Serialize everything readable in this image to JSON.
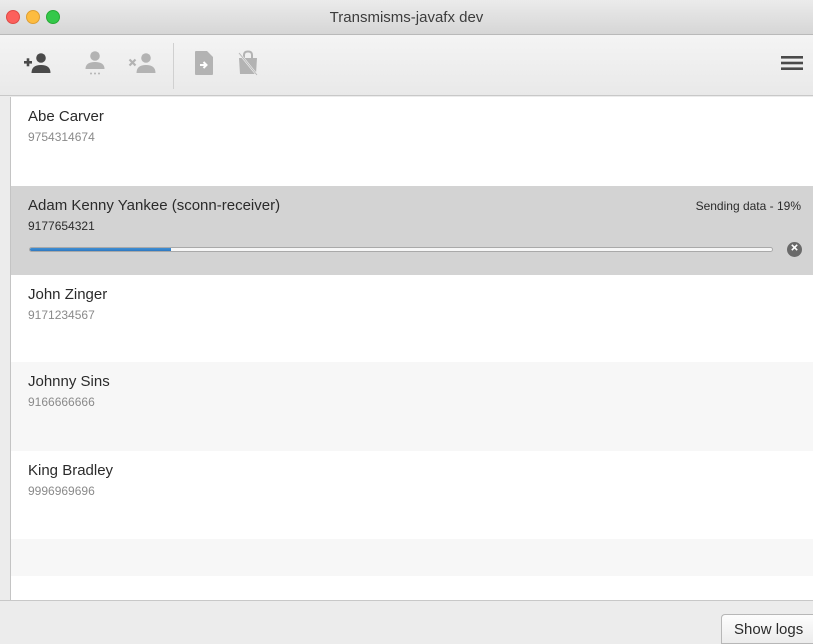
{
  "window": {
    "title": "Transmisms-javafx dev"
  },
  "toolbar": {
    "buttons": [
      {
        "icon": "add-contact-icon",
        "enabled": true
      },
      {
        "icon": "contact-pending-icon",
        "enabled": false
      },
      {
        "icon": "remove-contact-icon",
        "enabled": false
      },
      {
        "icon": "send-file-icon",
        "enabled": false
      },
      {
        "icon": "locked-file-icon",
        "enabled": false
      }
    ],
    "menu_icon": "hamburger-menu-icon"
  },
  "contacts": [
    {
      "name": "Abe Carver",
      "number": "9754314674",
      "selected": false
    },
    {
      "name": "Adam Kenny Yankee (sconn-receiver)",
      "number": "9177654321",
      "selected": true,
      "status": "Sending data - 19%",
      "progress": 0.19
    },
    {
      "name": "John Zinger",
      "number": "9171234567",
      "selected": false
    },
    {
      "name": "Johnny Sins",
      "number": "9166666666",
      "selected": false
    },
    {
      "name": "King Bradley",
      "number": "9996969696",
      "selected": false
    }
  ],
  "footer": {
    "show_logs_label": "Show logs"
  },
  "colors": {
    "selected_row": "#d3d3d3",
    "progress_fill": "#3f8fd4",
    "enabled_icon": "#4a4a4a",
    "disabled_icon": "#b3b3b3"
  }
}
